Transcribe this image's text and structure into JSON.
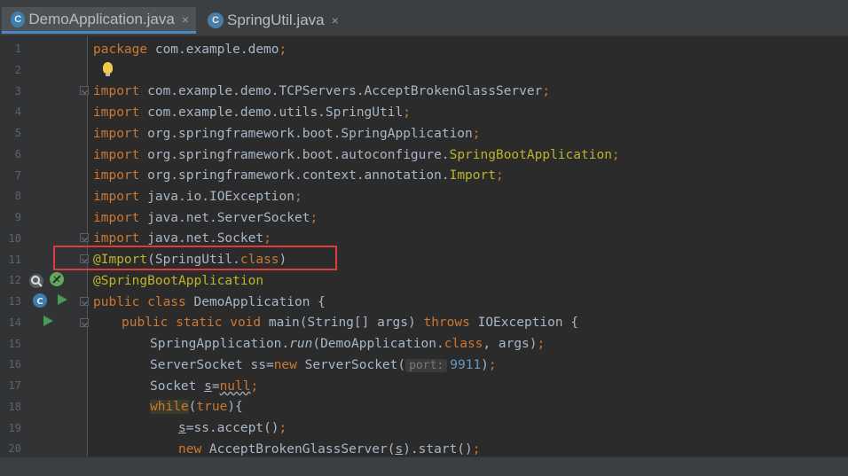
{
  "tabs": [
    {
      "label": "DemoApplication.java",
      "close": "×",
      "active": true
    },
    {
      "label": "SpringUtil.java",
      "close": "×",
      "active": false
    }
  ],
  "line_numbers": [
    "1",
    "2",
    "3",
    "4",
    "5",
    "6",
    "7",
    "8",
    "9",
    "10",
    "11",
    "12",
    "13",
    "14",
    "15",
    "16",
    "17",
    "18",
    "19",
    "20"
  ],
  "code": {
    "l1_kw": "package",
    "l1_rest": " com.example.demo",
    "semi": ";",
    "import_kw": "import",
    "l3": " com.example.demo.TCPServers.AcceptBrokenGlassServer",
    "l4": " com.example.demo.utils.SpringUtil",
    "l5": " org.springframework.boot.SpringApplication",
    "l6_a": " org.springframework.boot.autoconfigure.",
    "l6_b": "SpringBootApplication",
    "l7_a": " org.springframework.context.annotation.",
    "l7_b": "Import",
    "l8": " java.io.IOException",
    "l9": " java.net.ServerSocket",
    "l10": " java.net.Socket",
    "l11_ann": "@Import",
    "l11_a": "(SpringUtil.",
    "l11_kw": "class",
    "l11_b": ")",
    "l12_ann": "@SpringBootApplication",
    "l13_kw": "public class",
    "l13_rest": " DemoApplication {",
    "l14_kw1": "public static void",
    "l14_a": " main(String[] args) ",
    "l14_kw2": "throws",
    "l14_b": " IOException {",
    "l15_a": "SpringApplication.",
    "l15_m": "run",
    "l15_b": "(DemoApplication.",
    "l15_kw": "class",
    "l15_c": ", args)",
    "l16_a": "ServerSocket ss=",
    "l16_kw": "new",
    "l16_b": " ServerSocket(",
    "l16_hint": "port:",
    "l16_num": "9911",
    "l16_c": ")",
    "l17_a": "Socket ",
    "l17_var": "s",
    "l17_b": "=",
    "l17_kw": "null",
    "l18_kw": "while",
    "l18_a": "(",
    "l18_kw2": "true",
    "l18_b": "){",
    "l19_var": "s",
    "l19_a": "=ss.accept()",
    "l20_kw": "new",
    "l20_a": " AcceptBrokenGlassServer(",
    "l20_var": "s",
    "l20_b": ").start()"
  },
  "icons": {
    "tab1": "spring-boot-class-icon",
    "tab2": "class-icon",
    "bulb": "lightbulb-icon",
    "gutter": [
      "search-icon",
      "spring-bean-icon",
      "class-icon",
      "run-icon"
    ]
  },
  "colors": {
    "keyword": "#cc7832",
    "annotation": "#bbb529",
    "number": "#6897bb",
    "text": "#a9b7c6",
    "highlight_box": "#e0393e",
    "tab_underline": "#4a88c7"
  }
}
